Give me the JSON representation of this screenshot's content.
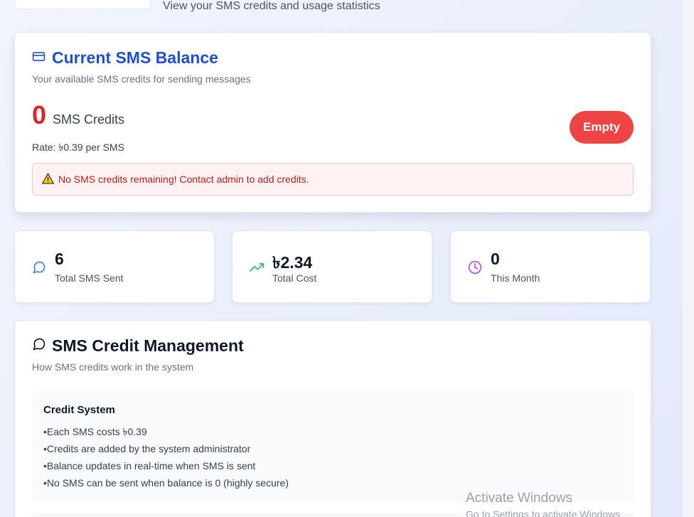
{
  "header": {
    "subtitle": "View your SMS credits and usage statistics"
  },
  "balance": {
    "title": "Current SMS Balance",
    "description": "Your available SMS credits for sending messages",
    "credits": "0",
    "credits_label": "SMS Credits",
    "rate": "Rate: ৳0.39 per SMS",
    "status_badge": "Empty",
    "alert": "No SMS credits remaining! Contact admin to add credits.",
    "icon": "credit-card-icon",
    "alert_icon": "warning-icon"
  },
  "stats": [
    {
      "value": "6",
      "label": "Total SMS Sent",
      "icon": "message-circle-icon",
      "color": "#3b82f6"
    },
    {
      "value": "৳2.34",
      "label": "Total Cost",
      "icon": "trending-up-icon",
      "color": "#22c55e"
    },
    {
      "value": "0",
      "label": "This Month",
      "icon": "clock-icon",
      "color": "#a855f7"
    }
  ],
  "management": {
    "title": "SMS Credit Management",
    "description": "How SMS credits work in the system",
    "icon": "message-circle-icon",
    "credit_system": {
      "title": "Credit System",
      "items": [
        "Each SMS costs ৳0.39",
        "Credits are added by the system administrator",
        "Balance updates in real-time when SMS is sent",
        "No SMS can be sent when balance is 0 (highly secure)"
      ]
    }
  },
  "watermark": {
    "title": "Activate Windows",
    "subtitle": "Go to Settings to activate Windows."
  },
  "colors": {
    "accent": "#1d4ed8",
    "danger": "#ef4444",
    "danger_text": "#dc2626"
  }
}
